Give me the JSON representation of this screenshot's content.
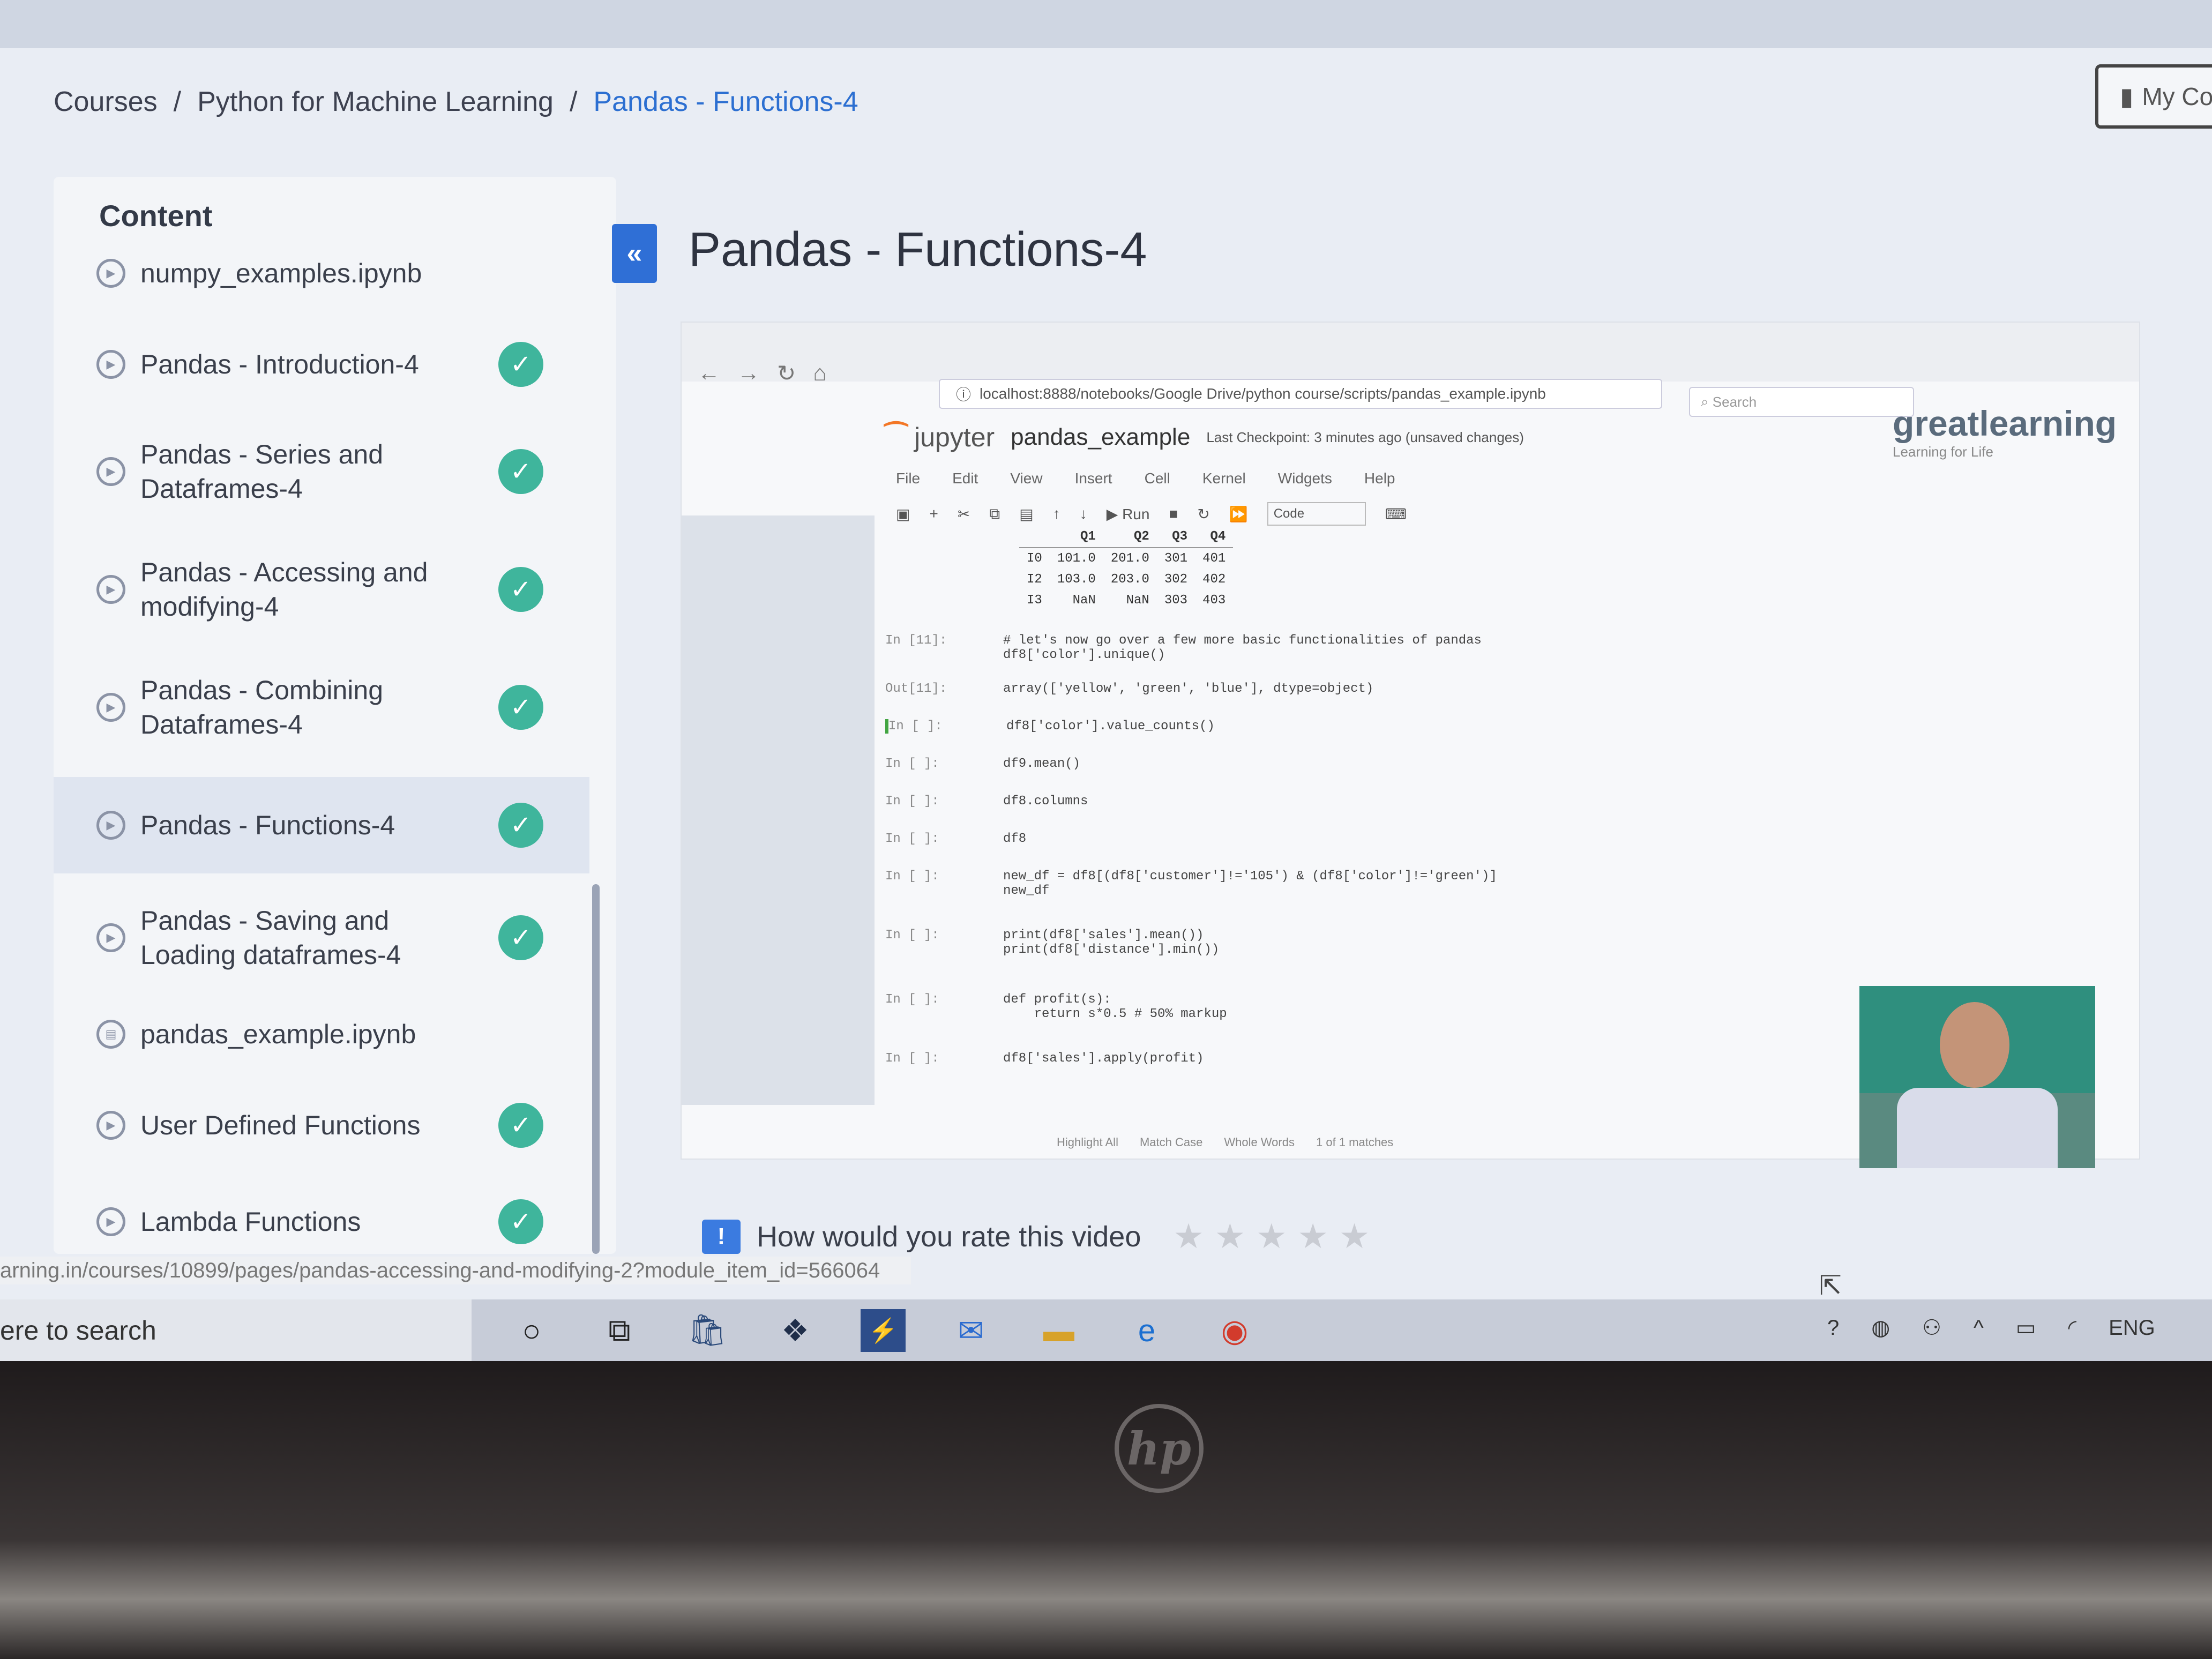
{
  "breadcrumb": {
    "courses": "Courses",
    "sep": "/",
    "course": "Python for Machine Learning",
    "current": "Pandas - Functions-4"
  },
  "my_courses_label": "My Co",
  "sidebar": {
    "title": "Content",
    "partial_item": "numpy_examples.ipynb",
    "items": [
      {
        "label": "Pandas - Introduction-4",
        "completed": true
      },
      {
        "label": "Pandas - Series and Dataframes-4",
        "completed": true
      },
      {
        "label": "Pandas - Accessing and modifying-4",
        "completed": true
      },
      {
        "label": "Pandas - Combining Dataframes-4",
        "completed": true
      },
      {
        "label": "Pandas - Functions-4",
        "completed": true,
        "active": true
      },
      {
        "label": "Pandas - Saving and Loading dataframes-4",
        "completed": true
      },
      {
        "label": "pandas_example.ipynb",
        "completed": false
      },
      {
        "label": "User Defined Functions",
        "completed": true
      },
      {
        "label": "Lambda Functions",
        "completed": true
      }
    ]
  },
  "collapse_icon": "«",
  "page_title": "Pandas - Functions-4",
  "video": {
    "browser": {
      "url": "localhost:8888/notebooks/Google Drive/python course/scripts/pandas_example.ipynb",
      "search_placeholder": "Search"
    },
    "brand": "greatlearning",
    "brand_tagline": "Learning for Life",
    "jupyter": {
      "logo": "jupyter",
      "notebook": "pandas_example",
      "checkpoint": "Last Checkpoint: 3 minutes ago  (unsaved changes)"
    },
    "menu": [
      "File",
      "Edit",
      "View",
      "Insert",
      "Cell",
      "Kernel",
      "Widgets",
      "Help"
    ],
    "toolbar": {
      "run": "Run",
      "cell_type": "Code"
    },
    "df_table": {
      "headers": [
        "",
        "Q1",
        "Q2",
        "Q3",
        "Q4"
      ],
      "rows": [
        [
          "I0",
          "101.0",
          "201.0",
          "301",
          "401"
        ],
        [
          "I2",
          "103.0",
          "203.0",
          "302",
          "402"
        ],
        [
          "I3",
          "NaN",
          "NaN",
          "303",
          "403"
        ]
      ]
    },
    "cells": [
      {
        "prompt": "In [11]:",
        "code": "# let's now go over a few more basic functionalities of pandas\ndf8['color'].unique()"
      },
      {
        "prompt": "Out[11]:",
        "code": "array(['yellow', 'green', 'blue'], dtype=object)"
      },
      {
        "prompt": "In [ ]:",
        "code": "df8['color'].value_counts()"
      },
      {
        "prompt": "In [ ]:",
        "code": "df9.mean()"
      },
      {
        "prompt": "In [ ]:",
        "code": "df8.columns"
      },
      {
        "prompt": "In [ ]:",
        "code": "df8"
      },
      {
        "prompt": "In [ ]:",
        "code": "new_df = df8[(df8['customer']!='105') & (df8['color']!='green')]\nnew_df"
      },
      {
        "prompt": "In [ ]:",
        "code": "print(df8['sales'].mean())\nprint(df8['distance'].min())"
      },
      {
        "prompt": "In [ ]:",
        "code": "def profit(s):\n    return s*0.5 # 50% markup"
      },
      {
        "prompt": "In [ ]:",
        "code": "df8['sales'].apply(profit)"
      }
    ],
    "findbar": [
      "Highlight All",
      "Match Case",
      "Whole Words",
      "1 of 1 matches"
    ]
  },
  "rating": {
    "icon": "!",
    "question": "How would you rate this video",
    "stars": 5
  },
  "status_url": "arning.in/courses/10899/pages/pandas-accessing-and-modifying-2?module_item_id=566064",
  "taskbar": {
    "search_text": "ere to search",
    "tray_lang": "ENG"
  },
  "laptop_logo": "hp"
}
